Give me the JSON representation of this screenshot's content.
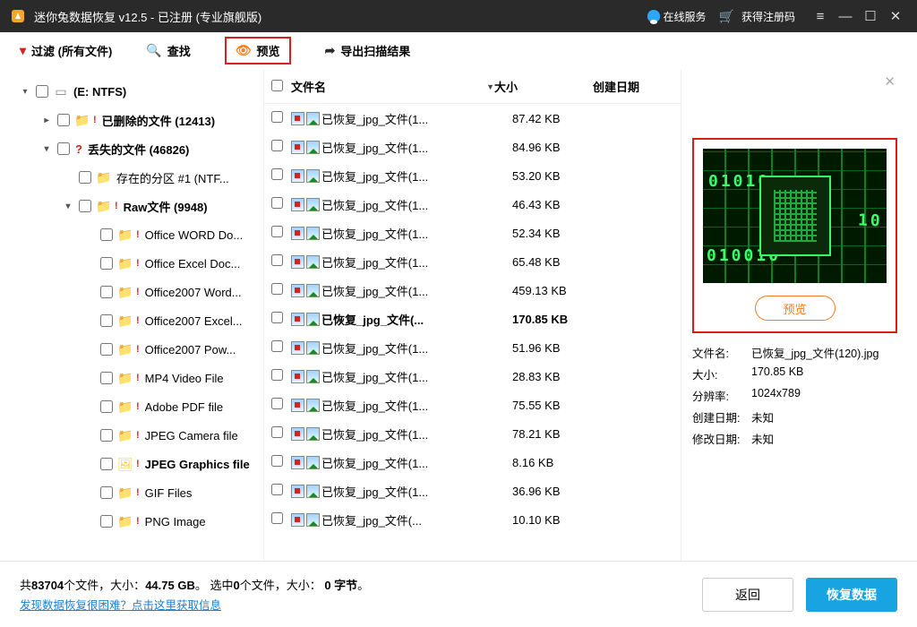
{
  "titlebar": {
    "title": "迷你兔数据恢复 v12.5 - 已注册 (专业旗舰版)",
    "online_service": "在线服务",
    "get_reg_code": "获得注册码"
  },
  "toolbar": {
    "filter": "过滤 (所有文件)",
    "find": "查找",
    "preview": "预览",
    "export": "导出扫描结果"
  },
  "tree": {
    "root": "(E: NTFS)",
    "deleted": "已删除的文件 (12413)",
    "lost": "丢失的文件 (46826)",
    "partition": "存在的分区 #1 (NTF...",
    "raw": "Raw文件 (9948)",
    "types": [
      "Office WORD Do...",
      "Office Excel Doc...",
      "Office2007 Word...",
      "Office2007 Excel...",
      "Office2007 Pow...",
      "MP4 Video File",
      "Adobe PDF file",
      "JPEG Camera file",
      "JPEG Graphics file",
      "GIF Files",
      "PNG Image"
    ]
  },
  "columns": {
    "name": "文件名",
    "size": "大小",
    "date": "创建日期"
  },
  "files": [
    {
      "name": "已恢复_jpg_文件(1...",
      "size": "87.42 KB",
      "sel": false
    },
    {
      "name": "已恢复_jpg_文件(1...",
      "size": "84.96 KB",
      "sel": false
    },
    {
      "name": "已恢复_jpg_文件(1...",
      "size": "53.20 KB",
      "sel": false
    },
    {
      "name": "已恢复_jpg_文件(1...",
      "size": "46.43 KB",
      "sel": false
    },
    {
      "name": "已恢复_jpg_文件(1...",
      "size": "52.34 KB",
      "sel": false
    },
    {
      "name": "已恢复_jpg_文件(1...",
      "size": "65.48 KB",
      "sel": false
    },
    {
      "name": "已恢复_jpg_文件(1...",
      "size": "459.13 KB",
      "sel": false
    },
    {
      "name": "已恢复_jpg_文件(...",
      "size": "170.85 KB",
      "sel": true
    },
    {
      "name": "已恢复_jpg_文件(1...",
      "size": "51.96 KB",
      "sel": false
    },
    {
      "name": "已恢复_jpg_文件(1...",
      "size": "28.83 KB",
      "sel": false
    },
    {
      "name": "已恢复_jpg_文件(1...",
      "size": "75.55 KB",
      "sel": false
    },
    {
      "name": "已恢复_jpg_文件(1...",
      "size": "78.21 KB",
      "sel": false
    },
    {
      "name": "已恢复_jpg_文件(1...",
      "size": "8.16 KB",
      "sel": false
    },
    {
      "name": "已恢复_jpg_文件(1...",
      "size": "36.96 KB",
      "sel": false
    },
    {
      "name": "已恢复_jpg_文件(...",
      "size": "10.10 KB",
      "sel": false
    }
  ],
  "preview": {
    "button": "预览",
    "labels": {
      "name": "文件名:",
      "size": "大小:",
      "res": "分辨率:",
      "created": "创建日期:",
      "modified": "修改日期:"
    },
    "name": "已恢复_jpg_文件(120).jpg",
    "size": "170.85 KB",
    "res": "1024x789",
    "created": "未知",
    "modified": "未知"
  },
  "footer": {
    "stats_p1": "共",
    "stats_c1": "83704",
    "stats_p2": "个文件，大小：",
    "stats_s1": "44.75 GB",
    "stats_p3": "。 选中",
    "stats_c2": "0",
    "stats_p4": "个文件，大小： ",
    "stats_s2": "0 字节",
    "stats_p5": "。",
    "help": "发现数据恢复很困难？点击这里获取信息",
    "back": "返回",
    "recover": "恢复数据"
  }
}
